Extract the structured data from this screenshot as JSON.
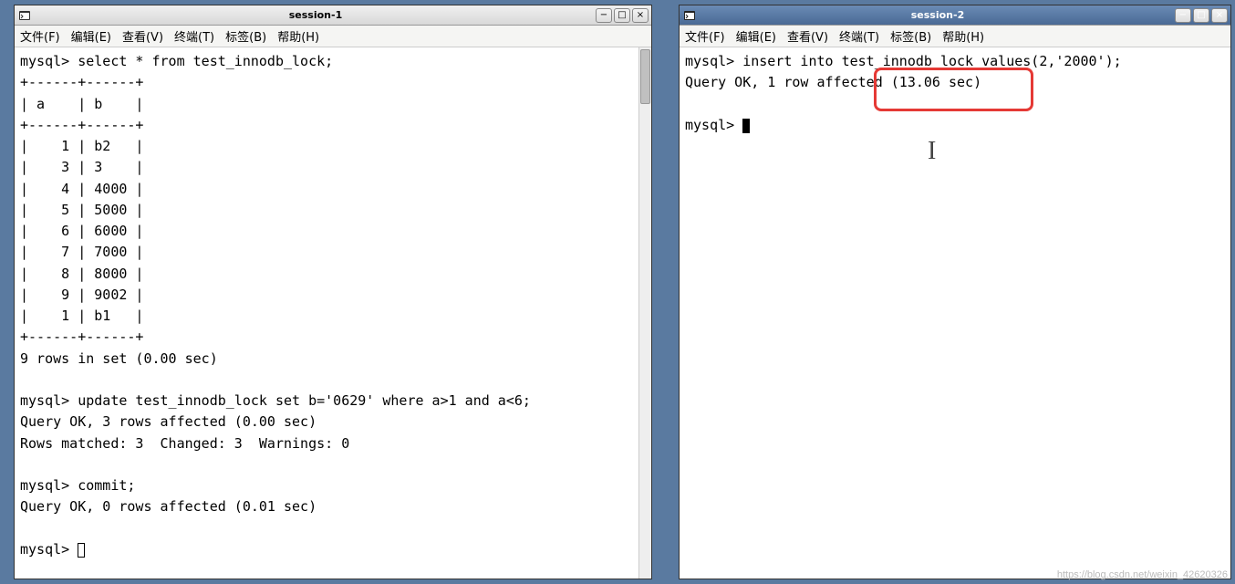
{
  "windows": {
    "session1": {
      "title": "session-1",
      "menu": [
        "文件(F)",
        "编辑(E)",
        "查看(V)",
        "终端(T)",
        "标签(B)",
        "帮助(H)"
      ],
      "terminal_lines": [
        "mysql> select * from test_innodb_lock;",
        "+------+------+",
        "| a    | b    |",
        "+------+------+",
        "|    1 | b2   |",
        "|    3 | 3    |",
        "|    4 | 4000 |",
        "|    5 | 5000 |",
        "|    6 | 6000 |",
        "|    7 | 7000 |",
        "|    8 | 8000 |",
        "|    9 | 9002 |",
        "|    1 | b1   |",
        "+------+------+",
        "9 rows in set (0.00 sec)",
        "",
        "mysql> update test_innodb_lock set b='0629' where a>1 and a<6;",
        "Query OK, 3 rows affected (0.00 sec)",
        "Rows matched: 3  Changed: 3  Warnings: 0",
        "",
        "mysql> commit;",
        "Query OK, 0 rows affected (0.01 sec)",
        "",
        "mysql> "
      ]
    },
    "session2": {
      "title": "session-2",
      "menu": [
        "文件(F)",
        "编辑(E)",
        "查看(V)",
        "终端(T)",
        "标签(B)",
        "帮助(H)"
      ],
      "terminal_lines": [
        "mysql> insert into test_innodb_lock values(2,'2000');",
        "Query OK, 1 row affected (13.06 sec)",
        "",
        "mysql> "
      ]
    }
  },
  "watermark": "https://blog.csdn.net/weixin_42620326"
}
